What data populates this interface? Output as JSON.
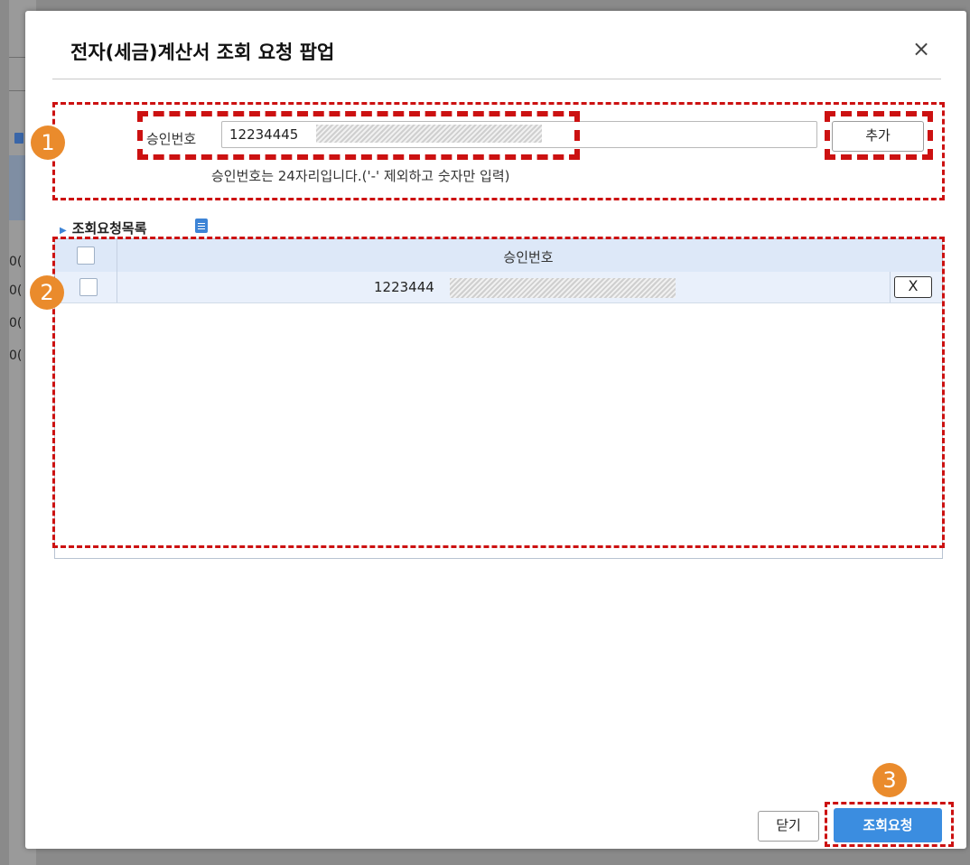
{
  "modal": {
    "title": "전자(세금)계산서 조회 요청 팝업",
    "close_icon": "×"
  },
  "form": {
    "approval_label": "승인번호",
    "approval_value": "12234445",
    "add_button": "추가",
    "hint": "승인번호는 24자리입니다.('-' 제외하고 숫자만 입력)"
  },
  "list": {
    "heading": "조회요청목록",
    "column_header": "승인번호",
    "rows": [
      {
        "approval_no": "1223444",
        "delete_label": "X"
      }
    ]
  },
  "footer": {
    "close_button": "닫기",
    "query_button": "조회요청"
  },
  "badges": [
    "1",
    "2",
    "3"
  ],
  "background": {
    "row_fragments": [
      "0(",
      "0(",
      "0(",
      "0("
    ]
  },
  "colors": {
    "highlight": "#cc1111",
    "badge": "#ea8b2c",
    "primary_button": "#3b8de0",
    "table_header": "#dde8f8"
  }
}
